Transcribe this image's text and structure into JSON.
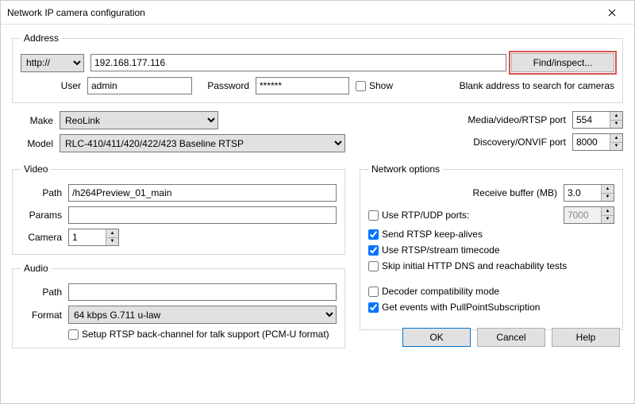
{
  "window": {
    "title": "Network IP camera configuration"
  },
  "address": {
    "legend": "Address",
    "scheme_selected": "http://",
    "host": "192.168.177.116",
    "find_label": "Find/inspect...",
    "user_label": "User",
    "user_value": "admin",
    "password_label": "Password",
    "password_value": "******",
    "show_label": "Show",
    "hint": "Blank address to search for cameras"
  },
  "make": {
    "label": "Make",
    "selected": "ReoLink"
  },
  "model": {
    "label": "Model",
    "selected": "RLC-410/411/420/422/423 Baseline RTSP"
  },
  "ports": {
    "rtsp_label": "Media/video/RTSP port",
    "rtsp_value": "554",
    "onvif_label": "Discovery/ONVIF port",
    "onvif_value": "8000"
  },
  "video": {
    "legend": "Video",
    "path_label": "Path",
    "path_value": "/h264Preview_01_main",
    "params_label": "Params",
    "params_value": "",
    "camera_label": "Camera",
    "camera_value": "1"
  },
  "audio": {
    "legend": "Audio",
    "path_label": "Path",
    "path_value": "",
    "format_label": "Format",
    "format_selected": "64 kbps G.711 u-law",
    "backchannel_label": "Setup RTSP back-channel for talk support (PCM-U format)"
  },
  "netopt": {
    "legend": "Network options",
    "recvbuf_label": "Receive buffer (MB)",
    "recvbuf_value": "3.0",
    "use_rtp_label": "Use RTP/UDP ports:",
    "use_rtp_value": "7000",
    "keepalive_label": "Send RTSP keep-alives",
    "timecode_label": "Use RTSP/stream timecode",
    "skipdns_label": "Skip initial HTTP DNS and reachability tests",
    "decoder_label": "Decoder compatibility mode",
    "pullpoint_label": "Get events with PullPointSubscription"
  },
  "buttons": {
    "ok": "OK",
    "cancel": "Cancel",
    "help": "Help"
  }
}
